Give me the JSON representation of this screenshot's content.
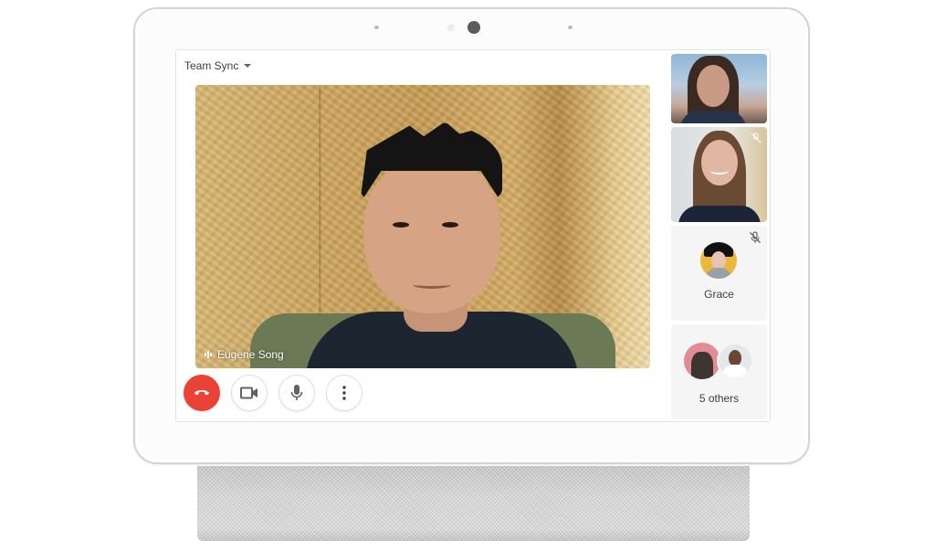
{
  "meeting": {
    "title": "Team Sync",
    "title_dropdown_icon": "caret-down-icon"
  },
  "main_video": {
    "speaker_name": "Eugene Song",
    "speaking_indicator_icon": "audio-level-icon"
  },
  "controls": [
    {
      "name": "end-call",
      "icon": "phone-hangup-icon",
      "color": "#ea4335"
    },
    {
      "name": "camera",
      "icon": "videocam-icon"
    },
    {
      "name": "microphone",
      "icon": "mic-icon"
    },
    {
      "name": "more-options",
      "icon": "more-vert-icon"
    }
  ],
  "participants": [
    {
      "type": "video",
      "muted": false
    },
    {
      "type": "video",
      "muted": true
    },
    {
      "type": "avatar",
      "name": "Grace",
      "muted": true
    },
    {
      "type": "group",
      "label": "5 others"
    }
  ],
  "colors": {
    "end_call": "#ea4335",
    "icon_gray": "#5f6368",
    "text": "#3c4043",
    "tile_bg": "#f5f5f5"
  }
}
